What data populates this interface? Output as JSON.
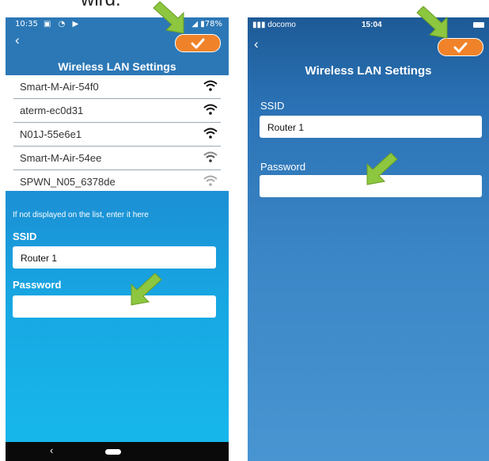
{
  "caption": "wird.",
  "left_phone": {
    "status": {
      "time": "10:35",
      "icons_left": "▣ ◔ ▶",
      "battery": "◢ ▮78%"
    },
    "back_icon": "‹",
    "title": "Wireless LAN Settings",
    "networks": [
      {
        "name": "Smart-M-Air-54f0"
      },
      {
        "name": "aterm-ec0d31"
      },
      {
        "name": "N01J-55e6e1"
      },
      {
        "name": "Smart-M-Air-54ee"
      },
      {
        "name": "SPWN_N05_6378de"
      }
    ],
    "hint": "If not displayed on the list, enter it here",
    "ssid_label": "SSID",
    "ssid_value": "Router 1",
    "password_label": "Password",
    "password_value": "",
    "nav_back": "‹"
  },
  "right_phone": {
    "status": {
      "carrier": "▮▮▮ docomo",
      "time": "15:04"
    },
    "back_icon": "‹",
    "title": "Wireless LAN Settings",
    "ssid_label": "SSID",
    "ssid_value": "Router 1",
    "password_label": "Password",
    "password_value": ""
  },
  "colors": {
    "header_blue": "#2c78b6",
    "form_blue": "#17a7e2",
    "confirm_orange": "#f0832a",
    "arrow_green": "#8dc63f"
  },
  "icons": [
    "back-icon",
    "checkmark-icon",
    "wifi-icon",
    "pointer-arrow-icon"
  ]
}
